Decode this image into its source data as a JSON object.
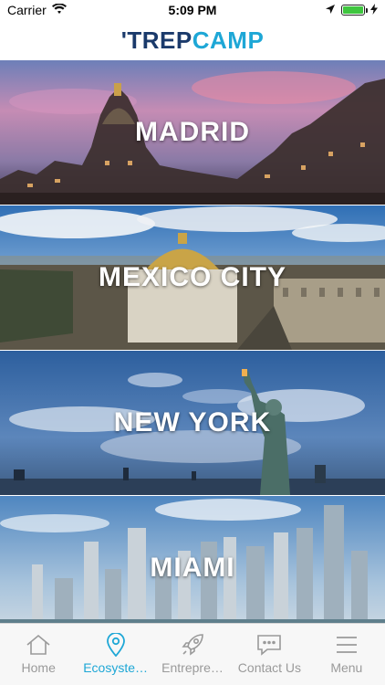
{
  "status_bar": {
    "carrier": "Carrier",
    "time": "5:09 PM",
    "battery_level": 1.0
  },
  "header": {
    "logo_tick": "'",
    "logo_trep": "TREP",
    "logo_camp": "CAMP"
  },
  "cities": [
    {
      "name": "MADRID"
    },
    {
      "name": "MEXICO CITY"
    },
    {
      "name": "NEW YORK"
    },
    {
      "name": "MIAMI"
    }
  ],
  "tabs": [
    {
      "label": "Home",
      "icon": "home-icon",
      "active": false
    },
    {
      "label": "Ecosyste…",
      "icon": "location-pin-icon",
      "active": true
    },
    {
      "label": "Entrepre…",
      "icon": "rocket-icon",
      "active": false
    },
    {
      "label": "Contact Us",
      "icon": "chat-icon",
      "active": false
    },
    {
      "label": "Menu",
      "icon": "menu-icon",
      "active": false
    }
  ],
  "colors": {
    "accent": "#1ea7d6",
    "brand_dark": "#1a3a6b",
    "inactive": "#9a9a9a"
  }
}
